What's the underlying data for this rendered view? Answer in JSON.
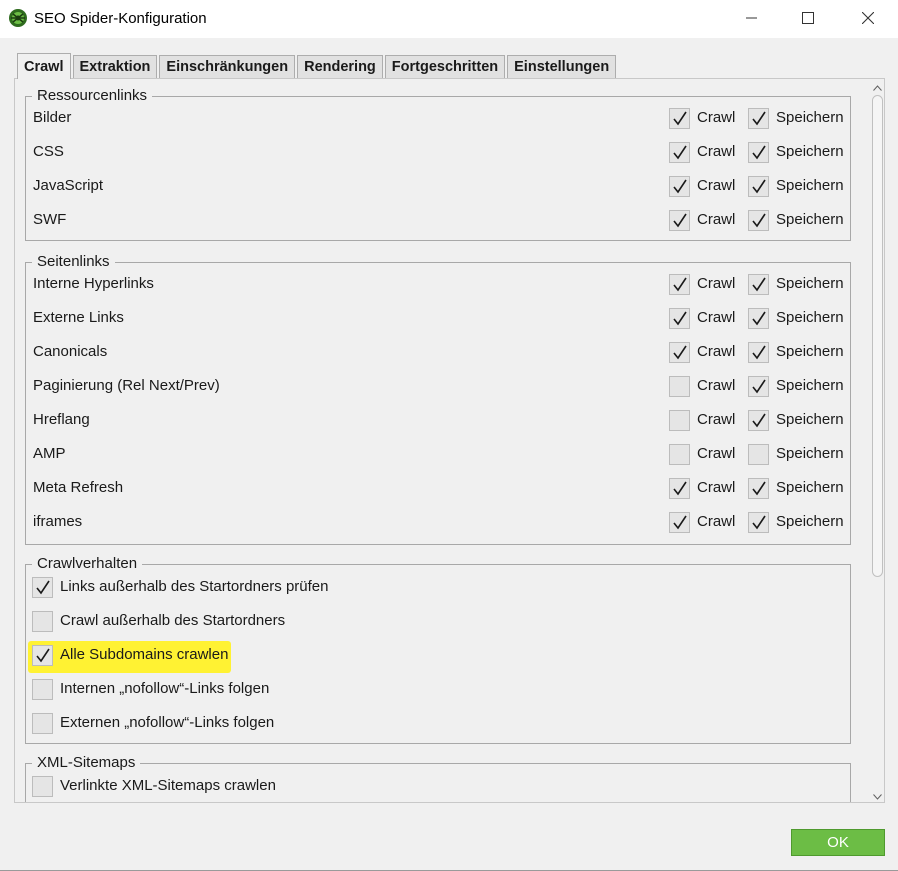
{
  "window": {
    "title": "SEO Spider-Konfiguration",
    "accent_color": "#6cbd45"
  },
  "tabs": [
    {
      "label": "Crawl",
      "active": true
    },
    {
      "label": "Extraktion",
      "active": false
    },
    {
      "label": "Einschränkungen",
      "active": false
    },
    {
      "label": "Rendering",
      "active": false
    },
    {
      "label": "Fortgeschritten",
      "active": false
    },
    {
      "label": "Einstellungen",
      "active": false
    }
  ],
  "crawl_label": "Crawl",
  "store_label": "Speichern",
  "resource_links": {
    "legend": "Ressourcenlinks",
    "items": [
      {
        "label": "Bilder",
        "crawl": true,
        "store": true
      },
      {
        "label": "CSS",
        "crawl": true,
        "store": true
      },
      {
        "label": "JavaScript",
        "crawl": true,
        "store": true
      },
      {
        "label": "SWF",
        "crawl": true,
        "store": true
      }
    ]
  },
  "page_links": {
    "legend": "Seitenlinks",
    "items": [
      {
        "label": "Interne Hyperlinks",
        "crawl": true,
        "store": true
      },
      {
        "label": "Externe Links",
        "crawl": true,
        "store": true
      },
      {
        "label": "Canonicals",
        "crawl": true,
        "store": true
      },
      {
        "label": "Paginierung (Rel Next/Prev)",
        "crawl": false,
        "store": true
      },
      {
        "label": "Hreflang",
        "crawl": false,
        "store": true
      },
      {
        "label": "AMP",
        "crawl": false,
        "store": false
      },
      {
        "label": "Meta Refresh",
        "crawl": true,
        "store": true
      },
      {
        "label": "iframes",
        "crawl": true,
        "store": true
      }
    ]
  },
  "crawl_behavior": {
    "legend": "Crawlverhalten",
    "items": [
      {
        "label": "Links außerhalb des Startordners prüfen",
        "checked": true
      },
      {
        "label": "Crawl außerhalb des Startordners",
        "checked": false
      },
      {
        "label": "Alle Subdomains crawlen",
        "checked": true,
        "highlighted": true
      },
      {
        "label": "Internen „nofollow“-Links folgen",
        "checked": false
      },
      {
        "label": "Externen „nofollow“-Links folgen",
        "checked": false
      }
    ]
  },
  "xml_sitemaps": {
    "legend": "XML-Sitemaps",
    "items": [
      {
        "label": "Verlinkte XML-Sitemaps crawlen",
        "checked": false
      }
    ]
  },
  "ok_button": {
    "label": "OK"
  },
  "highlight_color": "#fff233"
}
